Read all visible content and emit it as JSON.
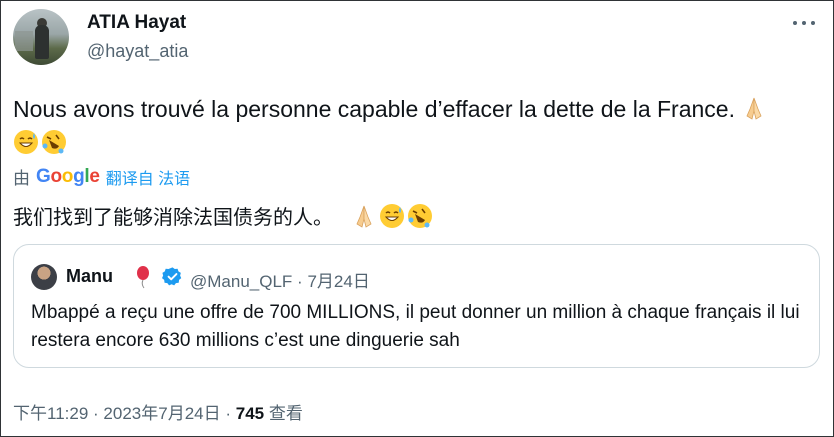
{
  "author": {
    "name": "ATIA Hayat",
    "handle": "@hayat_atia"
  },
  "tweet": {
    "text": "Nous avons trouvé la personne capable d’effacer la dette de la France.",
    "emojis": [
      "folded-hands",
      "grinning-sweat",
      "rolling-laughing"
    ]
  },
  "translation": {
    "by_label": "由",
    "provider": "Google",
    "action_label": "翻译自 法语",
    "text": "我们找到了能够消除法国债务的人。"
  },
  "quote": {
    "name": "Manu",
    "handle": "@Manu_QLF",
    "separator": "·",
    "date": "7月24日",
    "text": "Mbappé a reçu une offre de 700 MILLIONS, il peut donner un million à chaque français il lui restera encore 630 millions c’est une dinguerie sah"
  },
  "footer": {
    "time": "下午11:29",
    "sep1": "·",
    "date": "2023年7月24日",
    "sep2": "·",
    "views_count": "745",
    "views_label": "查看"
  },
  "colors": {
    "text": "#0f1419",
    "secondary": "#536471",
    "link": "#1d9bf0",
    "border": "#cfd9de"
  }
}
